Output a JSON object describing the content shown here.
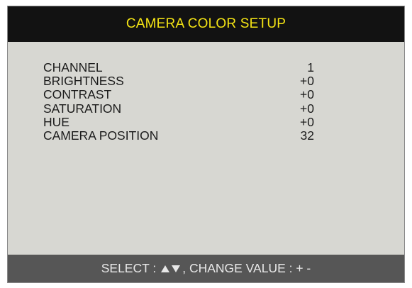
{
  "window": {
    "title": "CAMERA COLOR SETUP"
  },
  "menu": {
    "items": [
      {
        "label": "CHANNEL",
        "value": "1"
      },
      {
        "label": "BRIGHTNESS",
        "value": "+0"
      },
      {
        "label": "CONTRAST",
        "value": "+0"
      },
      {
        "label": "SATURATION",
        "value": "+0"
      },
      {
        "label": "HUE",
        "value": "+0"
      },
      {
        "label": "CAMERA POSITION",
        "value": "32"
      }
    ]
  },
  "footer": {
    "select_label": "SELECT :",
    "arrow_icons": [
      "up-triangle-icon",
      "down-triangle-icon"
    ],
    "change_label": ", CHANGE VALUE : + -"
  },
  "colors": {
    "title_bar": "#121212",
    "title_text": "#f5e514",
    "panel_bg": "#d7d7d2",
    "footer_bar": "#565656",
    "footer_text": "#e8e8e8",
    "item_text": "#1b1b1b"
  }
}
